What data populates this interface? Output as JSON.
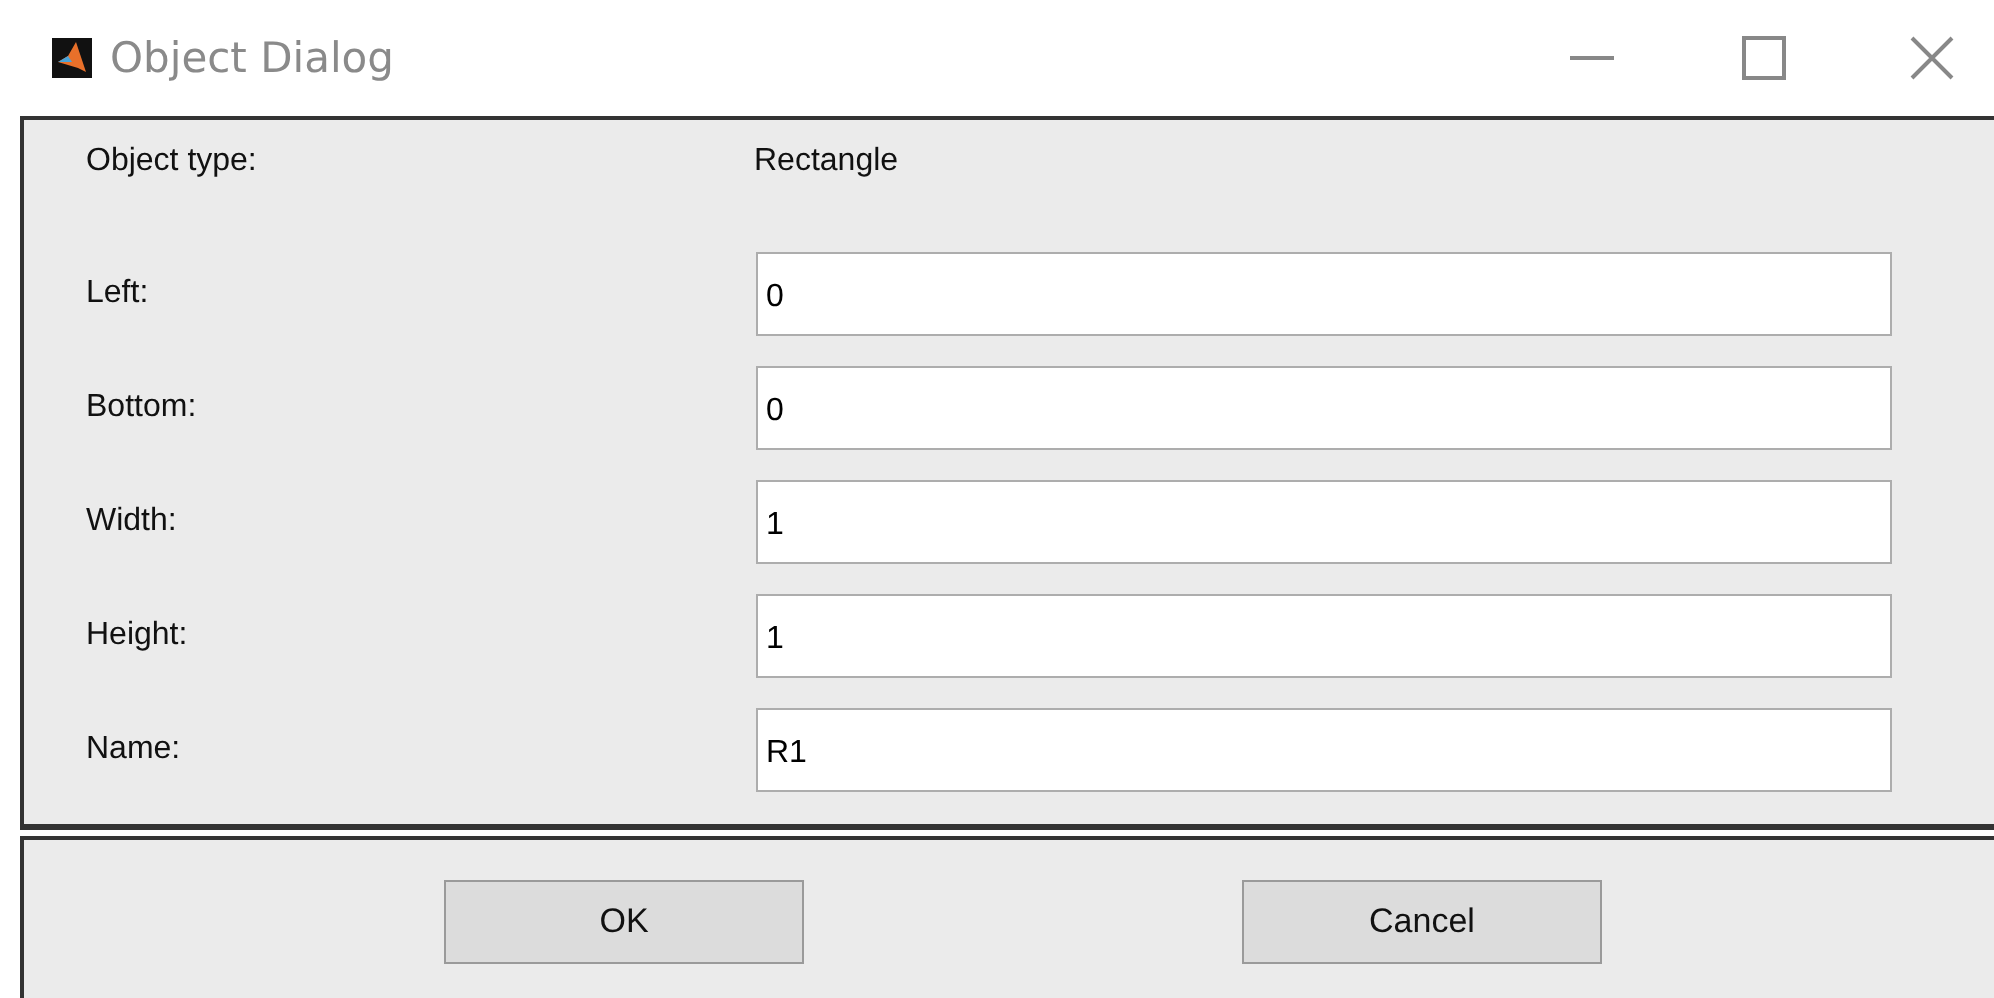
{
  "window": {
    "title": "Object Dialog"
  },
  "object_type": {
    "label": "Object type:",
    "value": "Rectangle"
  },
  "fields": [
    {
      "label": "Left:",
      "value": "0"
    },
    {
      "label": "Bottom:",
      "value": "0"
    },
    {
      "label": "Width:",
      "value": "1"
    },
    {
      "label": "Height:",
      "value": "1"
    },
    {
      "label": "Name:",
      "value": "R1"
    }
  ],
  "buttons": [
    "OK",
    "Cancel"
  ]
}
